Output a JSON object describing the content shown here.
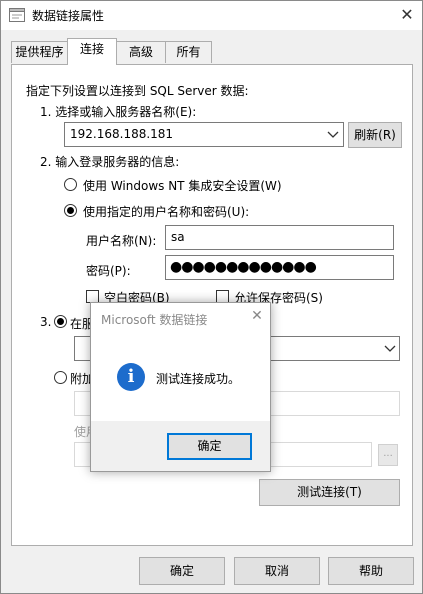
{
  "window": {
    "title": "数据链接属性"
  },
  "tabs": [
    {
      "label": "提供程序"
    },
    {
      "label": "连接"
    },
    {
      "label": "高级"
    },
    {
      "label": "所有"
    }
  ],
  "connection": {
    "intro": "指定下列设置以连接到 SQL Server 数据:",
    "step1_label": "1. 选择或输入服务器名称(E):",
    "server_value": "192.168.188.181",
    "refresh_label": "刷新(R)",
    "step2_label": "2. 输入登录服务器的信息:",
    "radio_windows": "使用 Windows NT 集成安全设置(W)",
    "radio_userpass": "使用指定的用户名称和密码(U):",
    "username_label": "用户名称(N):",
    "username_value": "sa",
    "password_label": "密码(P):",
    "password_value": "●●●●●●●●●●●●●",
    "blank_password_label": "空白密码(B)",
    "save_password_label": "允许保存密码(S)",
    "step3_prefix": "3.",
    "radio_db_partial": "在服",
    "radio_attach_partial": "附加",
    "use_partial": "使用",
    "browse_label": "...",
    "test_connection_label": "测试连接(T)"
  },
  "footer": {
    "ok_label": "确定",
    "cancel_label": "取消",
    "help_label": "帮助"
  },
  "messagebox": {
    "title": "Microsoft 数据链接",
    "message": "测试连接成功。",
    "icon": "info-icon",
    "ok_label": "确定"
  },
  "colors": {
    "accent": "#0078d7",
    "info_icon": "#1d6ccc"
  }
}
